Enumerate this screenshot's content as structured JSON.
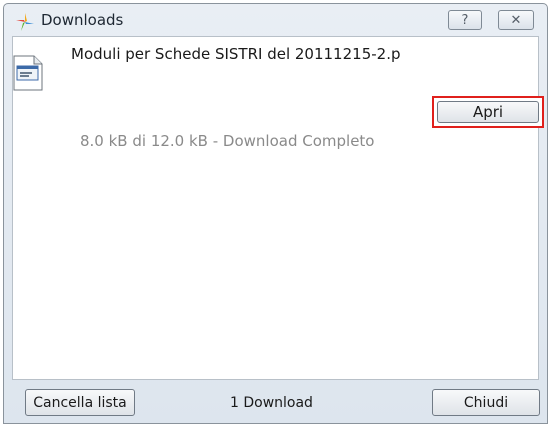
{
  "window": {
    "title": "Downloads",
    "help_label": "?",
    "close_label": "✕"
  },
  "download": {
    "file_name": "Moduli per Schede SISTRI del 20111215-2.p",
    "open_label": "Apri",
    "status": "8.0 kB di 12.0 kB - Download Completo"
  },
  "footer": {
    "clear_label": "Cancella lista",
    "count_label": "1 Download",
    "close_label": "Chiudi"
  },
  "colors": {
    "highlight": "#e0201c"
  }
}
